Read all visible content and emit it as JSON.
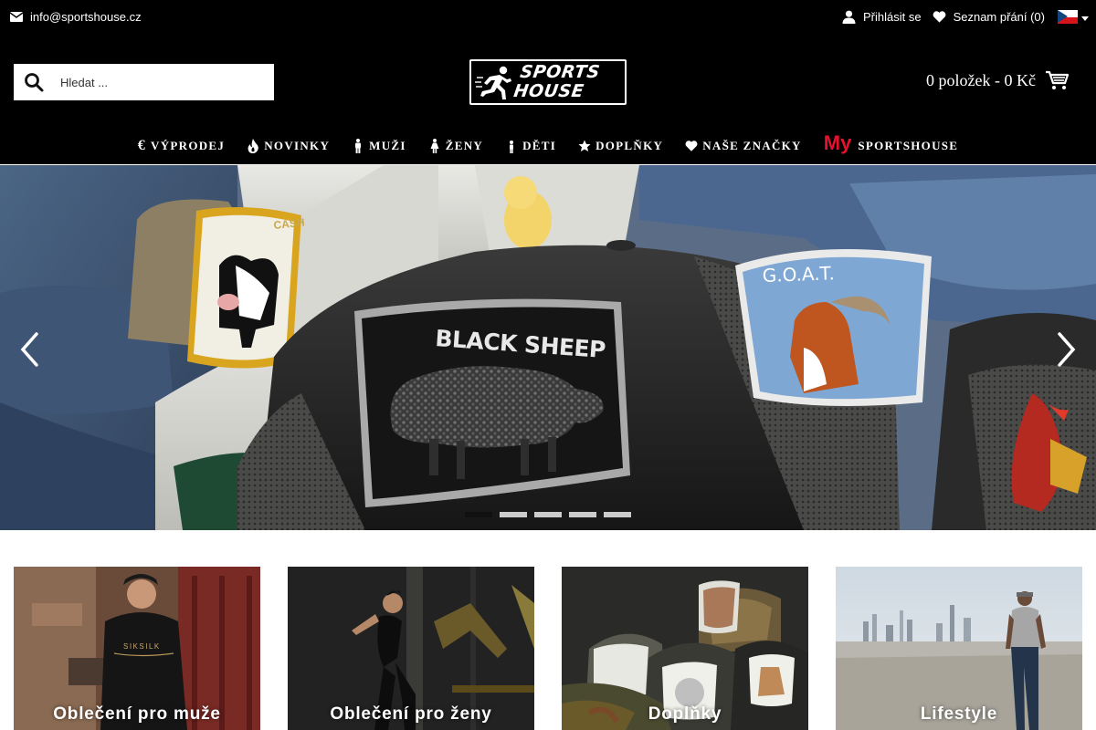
{
  "topbar": {
    "email": "info@sportshouse.cz",
    "login_label": "Přihlásit se",
    "wishlist_label": "Seznam přání (0)"
  },
  "search": {
    "placeholder": "Hledat ..."
  },
  "logo": {
    "line1": "SPORTS",
    "line2": "HOUSE"
  },
  "cart": {
    "label": "0 položek - 0 Kč"
  },
  "nav": {
    "sale": "VÝPRODEJ",
    "new": "NOVINKY",
    "men": "MUŽI",
    "women": "ŽENY",
    "kids": "DĚTI",
    "accessories": "DOPLŇKY",
    "brands": "NAŠE ZNAČKY",
    "my_prefix": "My",
    "my_suffix": "SPORTSHOUSE"
  },
  "hero": {
    "patch_cash": "CASH",
    "patch_blacksheep": "BLACK SHEEP",
    "patch_goat": "G.O.A.T.",
    "slides_count": 5,
    "active_slide": 1
  },
  "categories": [
    {
      "label": "Oblečení pro muže",
      "print": "SIKSILK"
    },
    {
      "label": "Oblečení pro ženy"
    },
    {
      "label": "Doplňky"
    },
    {
      "label": "Lifestyle"
    }
  ],
  "colors": {
    "header_bg": "#000000",
    "accent_red": "#e8112d",
    "text_light": "#ffffff"
  }
}
